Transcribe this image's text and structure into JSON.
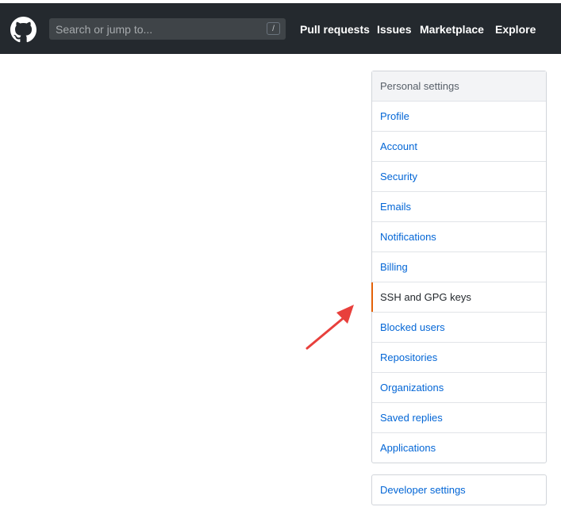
{
  "header": {
    "search_placeholder": "Search or jump to...",
    "search_shortcut": "/",
    "nav": [
      "Pull requests",
      "Issues",
      "Marketplace",
      "Explore"
    ]
  },
  "settings_menu": {
    "heading": "Personal settings",
    "items": [
      "Profile",
      "Account",
      "Security",
      "Emails",
      "Notifications",
      "Billing",
      "SSH and GPG keys",
      "Blocked users",
      "Repositories",
      "Organizations",
      "Saved replies",
      "Applications"
    ],
    "selected": "SSH and GPG keys"
  },
  "developer_menu": {
    "label": "Developer settings"
  },
  "colors": {
    "header_bg": "#24292e",
    "link": "#0366d6",
    "selected_accent": "#e36209",
    "annotation_arrow": "#e8403c"
  }
}
